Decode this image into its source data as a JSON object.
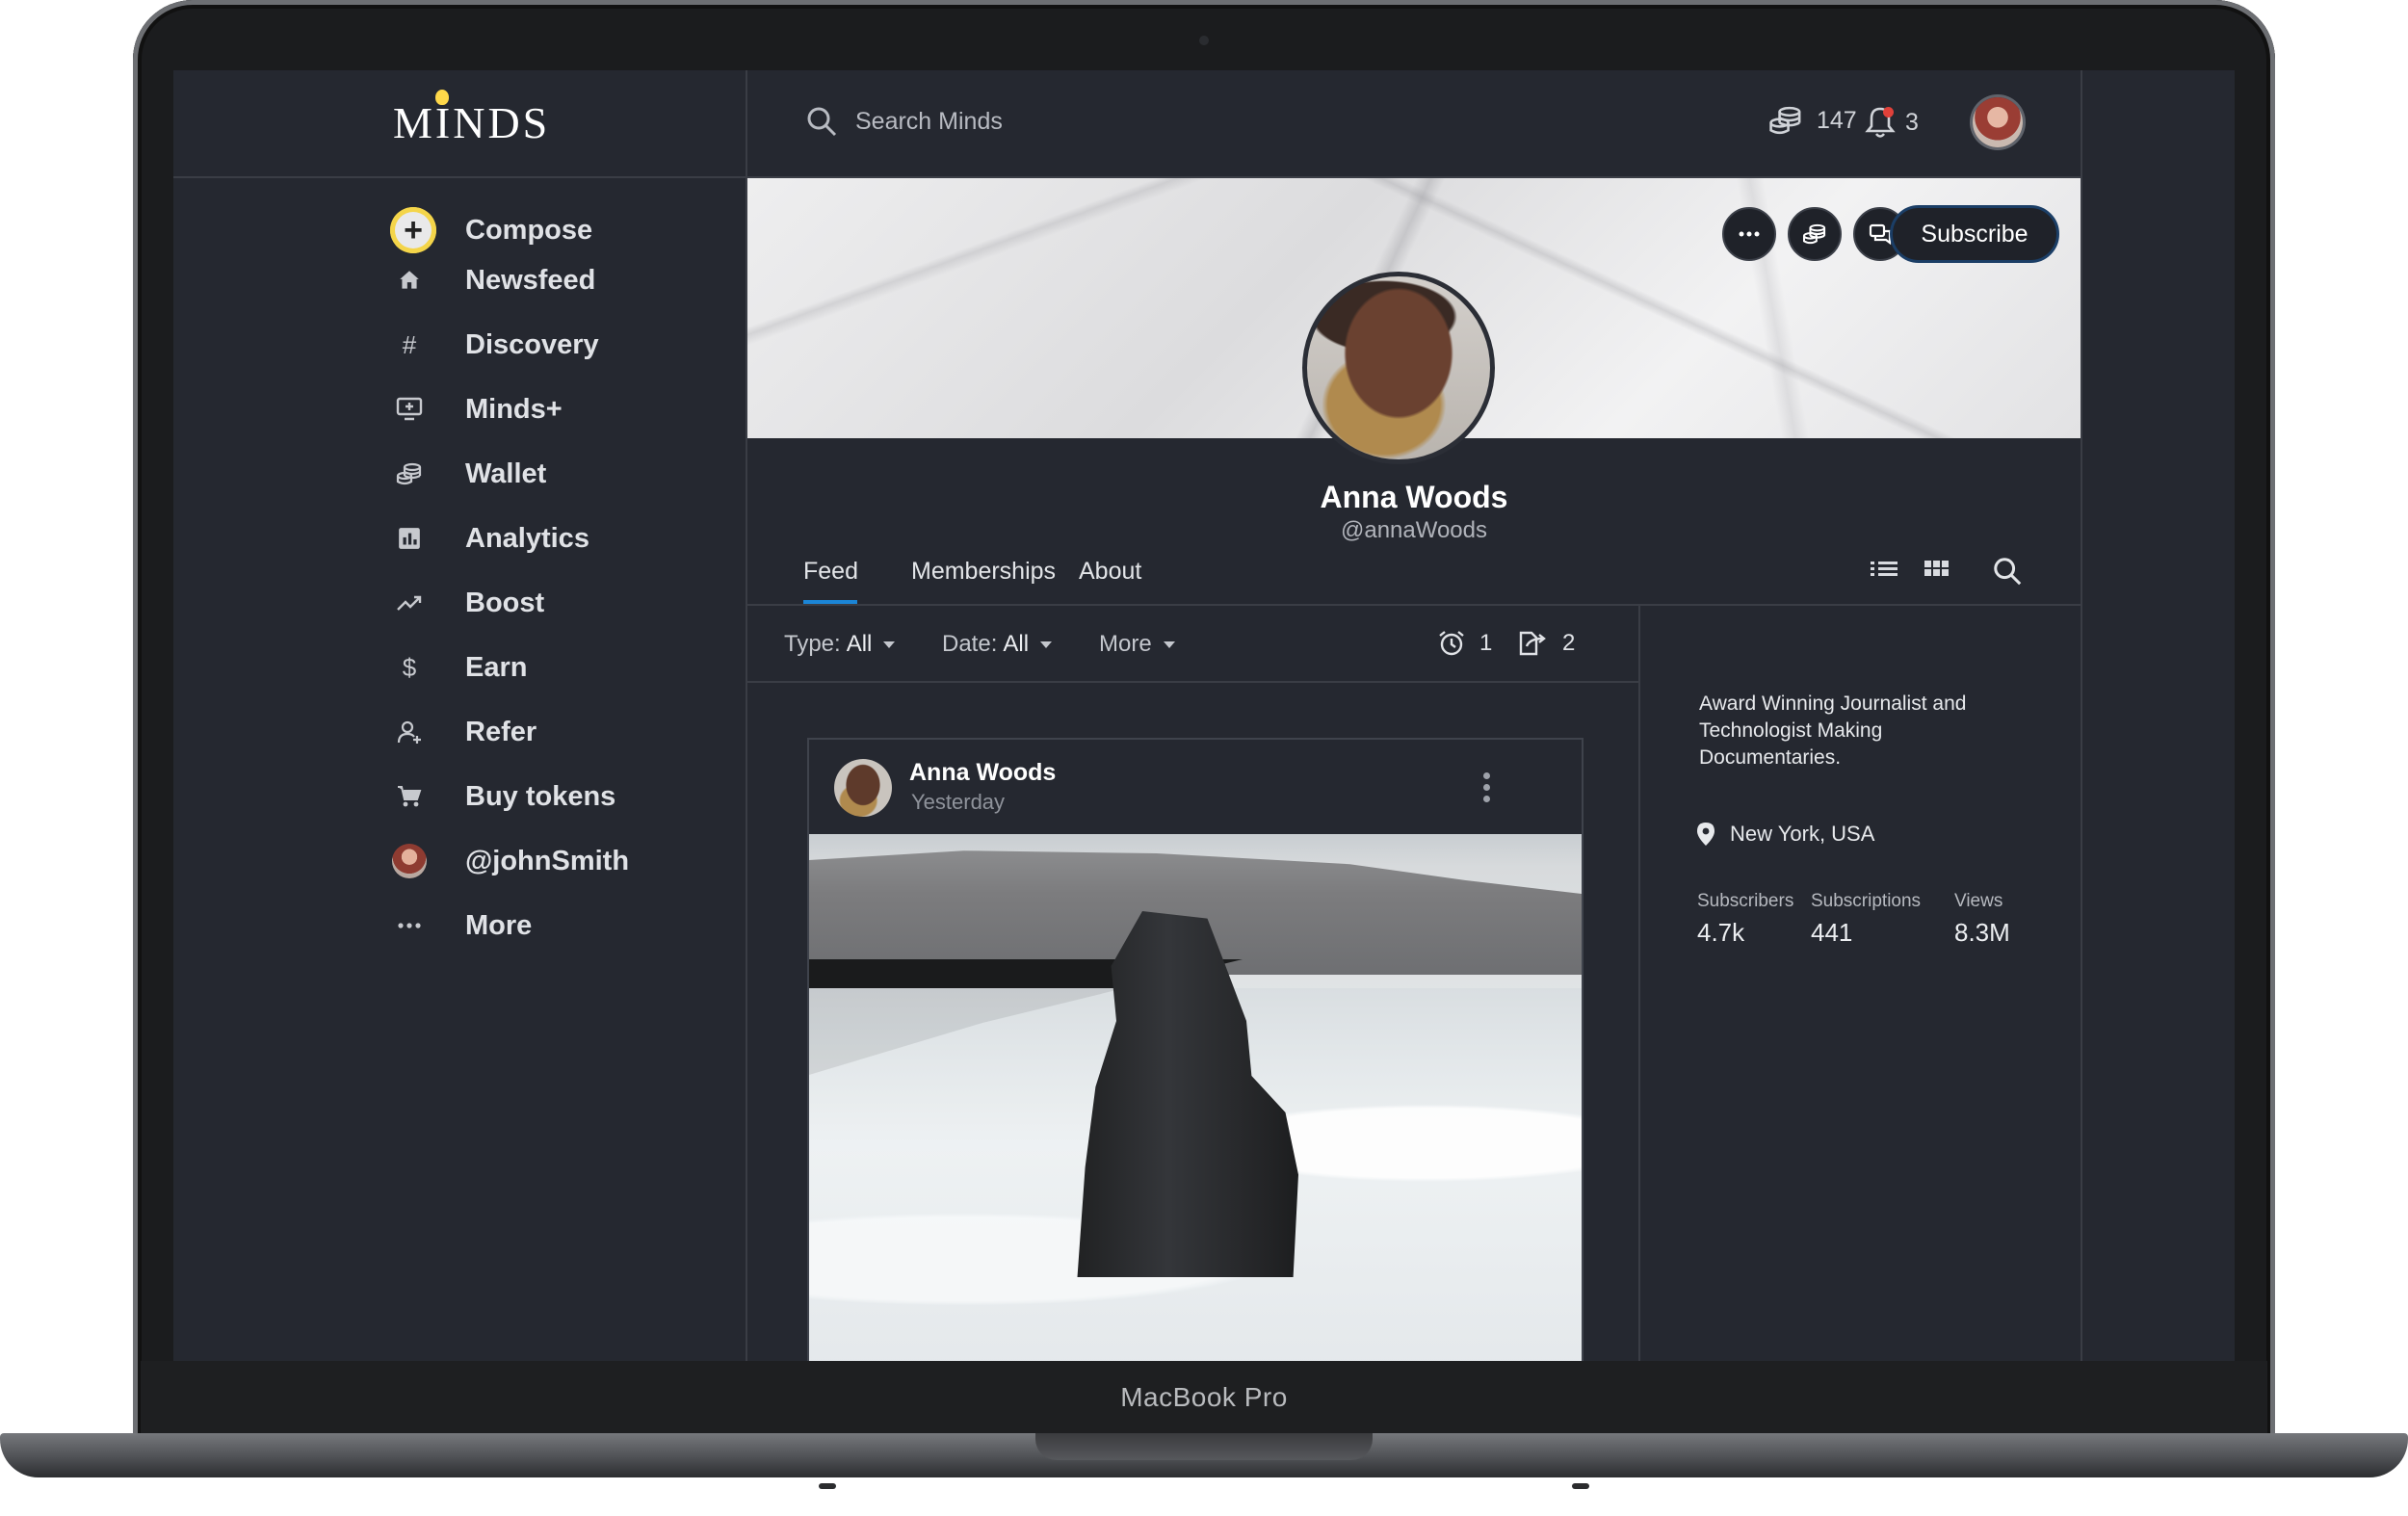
{
  "device": {
    "label": "MacBook Pro"
  },
  "app": {
    "logo": "MINDS"
  },
  "search": {
    "placeholder": "Search Minds"
  },
  "header": {
    "token_count": "147",
    "notification_count": "3"
  },
  "sidebar": {
    "items": [
      {
        "label": "Compose",
        "icon": "plus-icon"
      },
      {
        "label": "Newsfeed",
        "icon": "home-icon"
      },
      {
        "label": "Discovery",
        "icon": "hashtag-icon"
      },
      {
        "label": "Minds+",
        "icon": "monitor-plus-icon"
      },
      {
        "label": "Wallet",
        "icon": "coins-icon"
      },
      {
        "label": "Analytics",
        "icon": "bar-chart-icon"
      },
      {
        "label": "Boost",
        "icon": "trending-up-icon"
      },
      {
        "label": "Earn",
        "icon": "dollar-icon"
      },
      {
        "label": "Refer",
        "icon": "user-share-icon"
      },
      {
        "label": "Buy tokens",
        "icon": "cart-icon"
      },
      {
        "label": "@johnSmith",
        "icon": "avatar"
      },
      {
        "label": "More",
        "icon": "ellipsis-icon"
      }
    ]
  },
  "profile": {
    "name": "Anna Woods",
    "handle": "@annaWoods",
    "subscribe_label": "Subscribe",
    "bio": "Award Winning Journalist and Technologist Making Documentaries.",
    "location": "New York, USA",
    "stats": [
      {
        "label": "Subscribers",
        "value": "4.7k"
      },
      {
        "label": "Subscriptions",
        "value": "441"
      },
      {
        "label": "Views",
        "value": "8.3M"
      }
    ]
  },
  "tabs": [
    {
      "label": "Feed",
      "active": true
    },
    {
      "label": "Memberships",
      "active": false
    },
    {
      "label": "About",
      "active": false
    }
  ],
  "filters": {
    "type_label": "Type:",
    "type_value": "All",
    "date_label": "Date:",
    "date_value": "All",
    "more_label": "More",
    "scheduled_count": "1",
    "pending_count": "2"
  },
  "post": {
    "author": "Anna Woods",
    "time": "Yesterday"
  },
  "colors": {
    "accent": "#1b85d6",
    "background": "#252830",
    "compose": "#f4d54a",
    "notification_dot": "#e0413a"
  }
}
